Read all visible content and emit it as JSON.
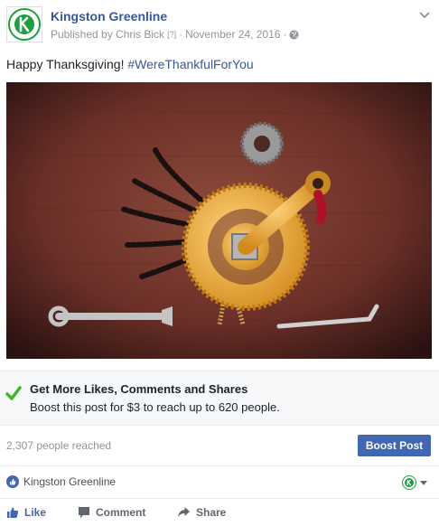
{
  "post": {
    "page_name": "Kingston Greenline",
    "published_by": "Published by Chris Bick",
    "help_marker": "[?]",
    "separator": "·",
    "date": "November 24, 2016",
    "text_plain": "Happy Thanksgiving! ",
    "hashtag": "#WereThankfulForYou"
  },
  "boost": {
    "title": "Get More Likes, Comments and Shares",
    "subtitle": "Boost this post for $3 to reach up to 620 people."
  },
  "stats": {
    "reach": "2,307 people reached",
    "boost_button": "Boost Post"
  },
  "identity": {
    "name": "Kingston Greenline"
  },
  "actions": {
    "like": "Like",
    "comment": "Comment",
    "share": "Share"
  },
  "colors": {
    "link": "#365899",
    "button": "#4267b2",
    "brand_green": "#1e9e3c"
  },
  "icons": [
    "kingston-logo-icon",
    "globe-icon",
    "chevron-down-icon",
    "checkmark-icon",
    "like-thumb-icon",
    "comment-icon",
    "share-icon"
  ]
}
